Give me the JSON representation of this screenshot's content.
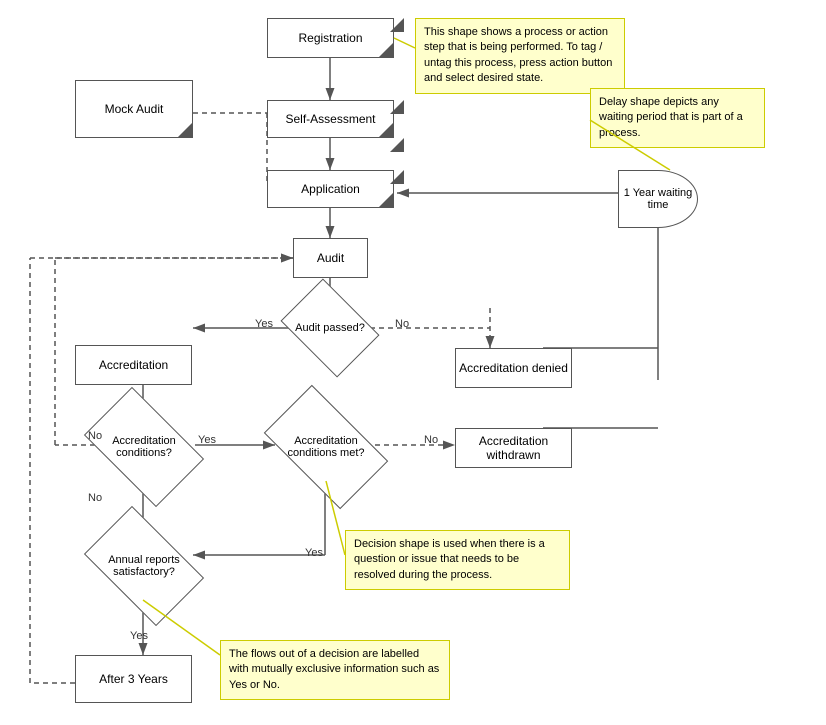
{
  "shapes": {
    "registration": {
      "label": "Registration"
    },
    "mock_audit": {
      "label": "Mock Audit"
    },
    "self_assessment": {
      "label": "Self-Assessment"
    },
    "application": {
      "label": "Application"
    },
    "audit": {
      "label": "Audit"
    },
    "audit_passed": {
      "label": "Audit passed?"
    },
    "accreditation": {
      "label": "Accreditation"
    },
    "accreditation_denied": {
      "label": "Accreditation denied"
    },
    "accreditation_conditions": {
      "label": "Accreditation conditions?"
    },
    "accreditation_conditions_met": {
      "label": "Accreditation conditions met?"
    },
    "accreditation_withdrawn": {
      "label": "Accreditation withdrawn"
    },
    "annual_reports": {
      "label": "Annual reports satisfactory?"
    },
    "after_years": {
      "label": "After 3 Years"
    },
    "delay": {
      "label": "1 Year waiting time"
    }
  },
  "tooltips": {
    "process": "This shape shows a process or action step that is being performed. To tag / untag this process, press action button and select desired state.",
    "delay": "Delay shape depicts any waiting period that is part of a process.",
    "decision": "Decision shape is used when there is a question or issue that needs to be resolved during the process.",
    "flows": "The flows out of a decision are labelled with mutually exclusive information such as Yes or No."
  },
  "flow_labels": {
    "no1": "No",
    "yes1": "Yes",
    "no2": "No",
    "yes2": "Yes",
    "no3": "No",
    "yes3": "Yes",
    "yes4": "Yes"
  }
}
